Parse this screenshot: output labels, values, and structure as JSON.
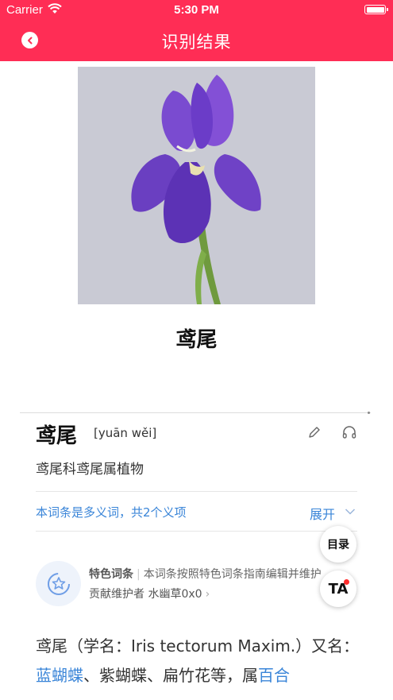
{
  "status_bar": {
    "carrier": "Carrier",
    "time": "5:30 PM"
  },
  "nav": {
    "title": "识别结果",
    "back_icon": "chevron-left-icon",
    "bar_color": "#ff2d55"
  },
  "result": {
    "name": "鸢尾"
  },
  "entry": {
    "title": "鸢尾",
    "pinyin": "[yuān wěi]",
    "summary": "鸢尾科鸢尾属植物",
    "polysemy_notice": "本词条是多义词，共2个义项",
    "expand_label": "展开",
    "featured": {
      "label": "特色词条",
      "description": "本词条按照特色词条指南编辑并维护",
      "maintainer": "贡献维护者 水幽草0x0",
      "maintainer_arrow": "›"
    },
    "body_text": {
      "part1": "鸢尾（学名：Iris tectorum Maxim.）又名：",
      "link1": "蓝蝴蝶",
      "part2": "、紫蝴蝶、扁竹花等，属",
      "link2": "百合"
    },
    "link_color": "#3a85d8"
  },
  "floating": {
    "toc_label": "目录",
    "ta_label": "TA"
  }
}
